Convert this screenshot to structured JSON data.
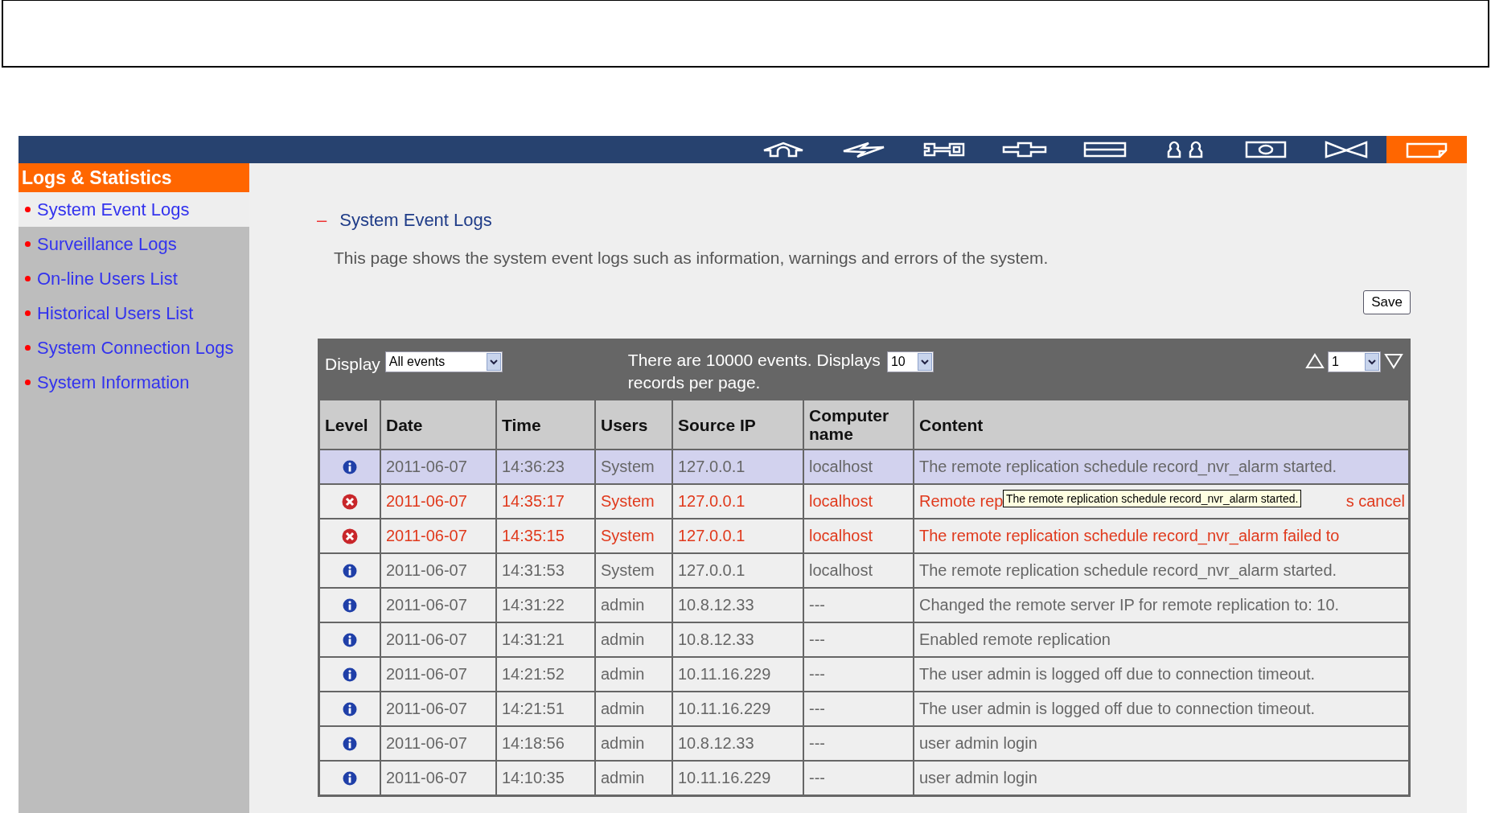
{
  "nav": [
    {
      "selected": false
    },
    {
      "selected": false
    },
    {
      "selected": false
    },
    {
      "selected": false
    },
    {
      "selected": false
    },
    {
      "selected": false
    },
    {
      "selected": false
    },
    {
      "selected": false
    },
    {
      "selected": true
    }
  ],
  "sidebar": {
    "title": "Logs & Statistics",
    "items": [
      {
        "label": "System Event Logs",
        "selected": true
      },
      {
        "label": "Surveillance Logs",
        "selected": false
      },
      {
        "label": "On-line Users List",
        "selected": false
      },
      {
        "label": "Historical Users List",
        "selected": false
      },
      {
        "label": "System Connection Logs",
        "selected": false
      },
      {
        "label": "System Information",
        "selected": false
      }
    ]
  },
  "section": {
    "marker": "–",
    "title": "System Event Logs",
    "description": "This page shows the system event logs such as information, warnings and errors of the system."
  },
  "save_button": "Save",
  "toolbar": {
    "display_label": "Display",
    "display_value": "All events",
    "summary": "There are 10000 events.  Displays",
    "per_page_value": "10",
    "per_page_suffix": "records per page.",
    "page_value": "1"
  },
  "table": {
    "columns": [
      "Level",
      "Date",
      "Time",
      "Users",
      "Source IP",
      "Computer name",
      "Content"
    ],
    "rows": [
      {
        "kind": "info",
        "selected": true,
        "date": "2011-06-07",
        "time": "14:36:23",
        "user": "System",
        "ip": "127.0.0.1",
        "computer": "localhost",
        "content": [
          "The remote replication schedule record_nvr_alarm started."
        ]
      },
      {
        "kind": "error",
        "selected": false,
        "date": "2011-06-07",
        "time": "14:35:17",
        "user": "System",
        "ip": "127.0.0.1",
        "computer": "localhost",
        "content": [
          "Remote rep",
          "s cancel"
        ],
        "tooltip": "The remote replication schedule record_nvr_alarm started."
      },
      {
        "kind": "error",
        "selected": false,
        "date": "2011-06-07",
        "time": "14:35:15",
        "user": "System",
        "ip": "127.0.0.1",
        "computer": "localhost",
        "content": [
          "The remote replication schedule record_nvr_alarm failed to"
        ]
      },
      {
        "kind": "info",
        "selected": false,
        "date": "2011-06-07",
        "time": "14:31:53",
        "user": "System",
        "ip": "127.0.0.1",
        "computer": "localhost",
        "content": [
          "The remote replication schedule record_nvr_alarm started."
        ]
      },
      {
        "kind": "info",
        "selected": false,
        "date": "2011-06-07",
        "time": "14:31:22",
        "user": "admin",
        "ip": "10.8.12.33",
        "computer": "---",
        "content": [
          "Changed the remote server IP for remote replication to: 10."
        ]
      },
      {
        "kind": "info",
        "selected": false,
        "date": "2011-06-07",
        "time": "14:31:21",
        "user": "admin",
        "ip": "10.8.12.33",
        "computer": "---",
        "content": [
          "Enabled remote replication"
        ]
      },
      {
        "kind": "info",
        "selected": false,
        "date": "2011-06-07",
        "time": "14:21:52",
        "user": "admin",
        "ip": "10.11.16.229",
        "computer": "---",
        "content": [
          "The user admin is logged off due to connection timeout."
        ]
      },
      {
        "kind": "info",
        "selected": false,
        "date": "2011-06-07",
        "time": "14:21:51",
        "user": "admin",
        "ip": "10.11.16.229",
        "computer": "---",
        "content": [
          "The user admin is logged off due to connection timeout."
        ]
      },
      {
        "kind": "info",
        "selected": false,
        "date": "2011-06-07",
        "time": "14:18:56",
        "user": "admin",
        "ip": "10.8.12.33",
        "computer": "---",
        "content": [
          "user admin login"
        ]
      },
      {
        "kind": "info",
        "selected": false,
        "date": "2011-06-07",
        "time": "14:10:35",
        "user": "admin",
        "ip": "10.11.16.229",
        "computer": "---",
        "content": [
          "user admin login"
        ]
      }
    ]
  }
}
